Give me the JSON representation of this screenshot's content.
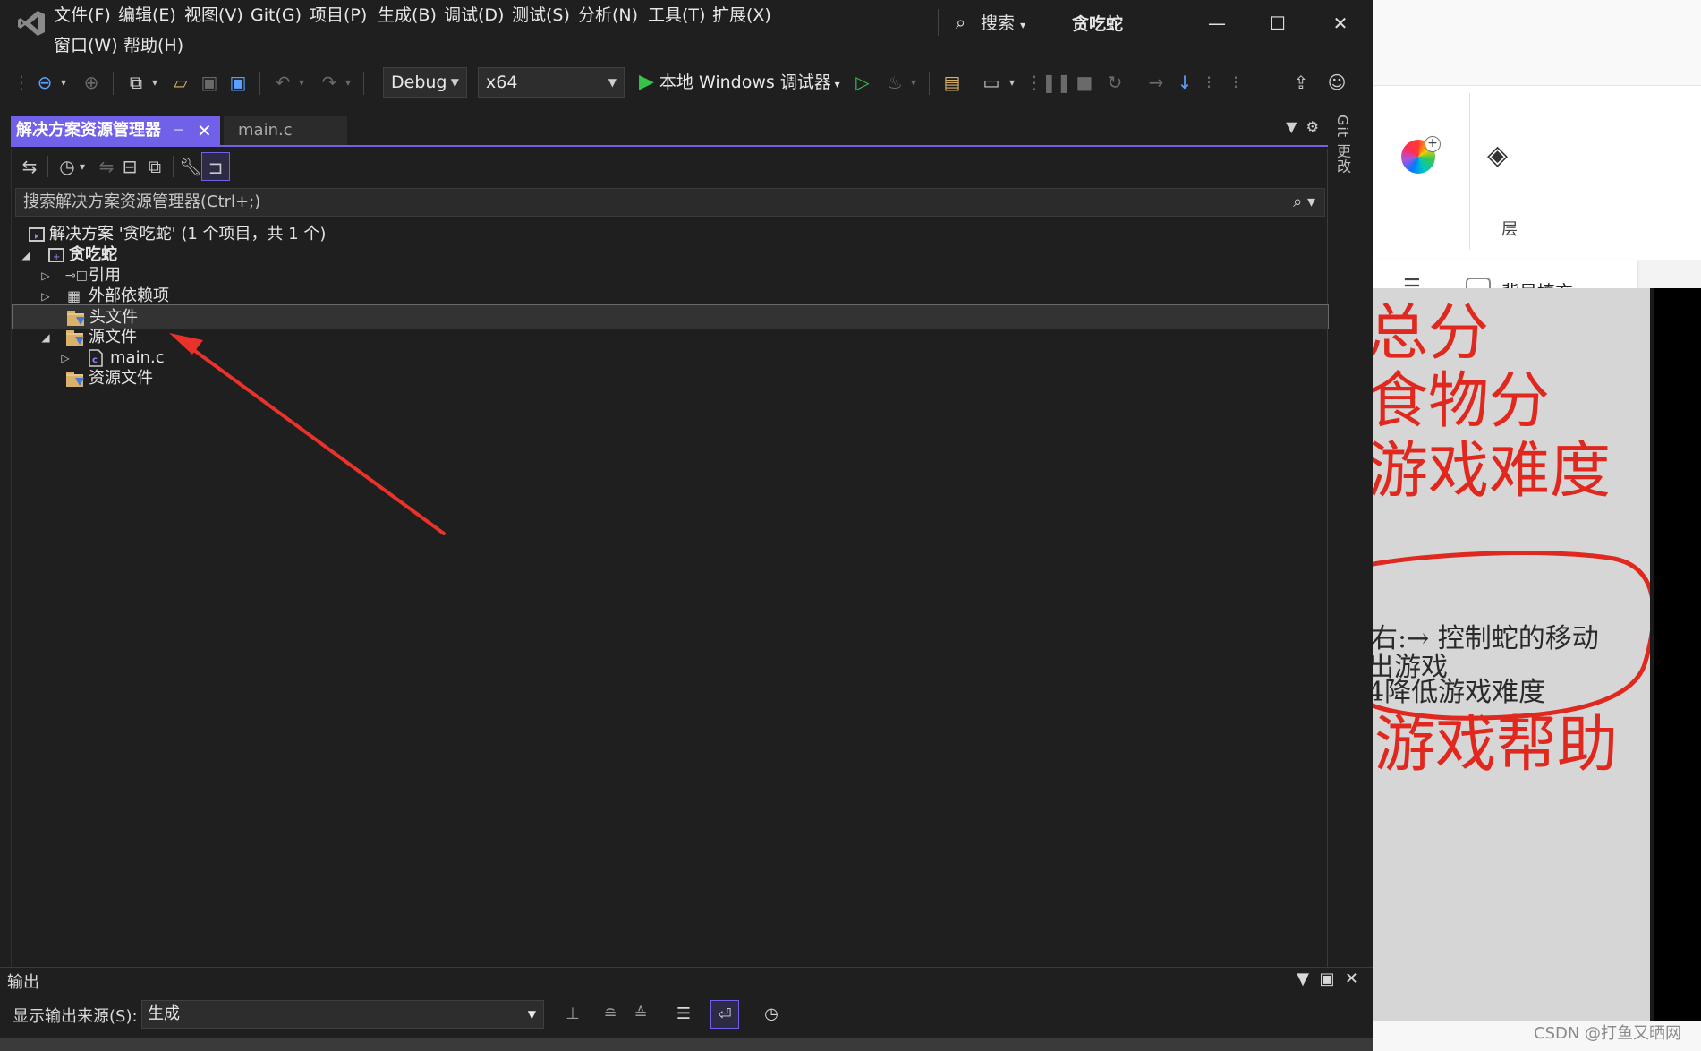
{
  "menu": {
    "file": "文件(F)",
    "edit": "编辑(E)",
    "view": "视图(V)",
    "git": "Git(G)",
    "project": "项目(P)",
    "build": "生成(B)",
    "debug": "调试(D)",
    "test": "测试(S)",
    "analyze": "分析(N)",
    "tools": "工具(T)",
    "extensions": "扩展(X)",
    "window": "窗口(W)",
    "help": "帮助(H)"
  },
  "search": {
    "label": "搜索"
  },
  "app": {
    "title": "贪吃蛇"
  },
  "toolbar": {
    "config": "Debug",
    "platform": "x64",
    "run_label": "本地 Windows 调试器"
  },
  "tabs": {
    "solution_explorer": "解决方案资源管理器",
    "main_c": "main.c"
  },
  "git_changes": "Git 更改",
  "solution_explorer": {
    "search_placeholder": "搜索解决方案资源管理器(Ctrl+;)",
    "tree": {
      "solution": "解决方案 '贪吃蛇' (1 个项目，共 1 个)",
      "project": "贪吃蛇",
      "references": "引用",
      "external_deps": "外部依赖项",
      "header_files": "头文件",
      "source_files": "源文件",
      "main_c": "main.c",
      "resource_files": "资源文件"
    }
  },
  "output": {
    "title": "输出",
    "source_label": "显示输出来源(S):",
    "source_value": "生成"
  },
  "paint": {
    "layers_label": "层",
    "background_fill": "背景填充"
  },
  "image_text": {
    "l1": "总分",
    "l2": "食物分",
    "l3": "游戏难度",
    "l4": "右:→  控制蛇的移动",
    "l5": "出游戏",
    "l6": "4降低游戏难度",
    "l7": "游戏帮助"
  },
  "watermark": "CSDN @打鱼又晒网",
  "colors": {
    "accent": "#7160e8",
    "annotation_arrow": "#e8322a",
    "annotation_ring": "#e0281e",
    "run_green": "#35c34b"
  },
  "icons": {
    "toolbar": [
      "back-icon",
      "forward-icon",
      "new-project-icon",
      "open-icon",
      "save-icon",
      "save-all-icon",
      "undo-icon",
      "redo-icon",
      "play-icon",
      "start-without-debug-icon"
    ],
    "solution_explorer": [
      "switch-views-icon",
      "history-icon",
      "sync-icon",
      "collapse-all-icon",
      "show-all-files-icon",
      "properties-icon",
      "preview-icon"
    ]
  }
}
